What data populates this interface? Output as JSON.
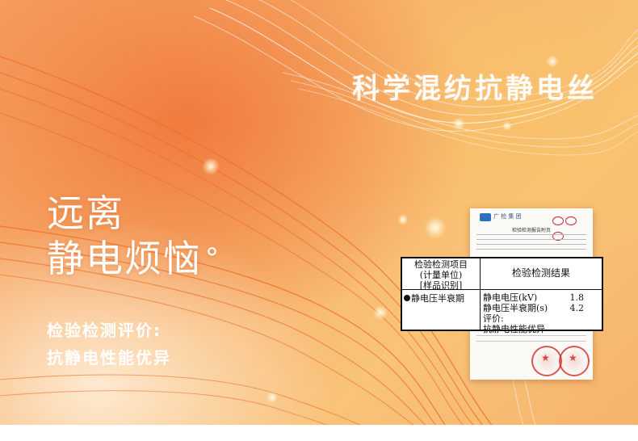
{
  "hero": {
    "headline": "科学混纺抗静电丝",
    "title_line1": "远离",
    "title_line2": "静电烦恼",
    "degree_mark": "°",
    "eval_line1": "检验检测评价:",
    "eval_line2": "抗静电性能优异"
  },
  "report": {
    "org_name": "广 检 集 团",
    "title": "检验检测报告附页"
  },
  "table": {
    "header_left": [
      "检验检测项目",
      "(计量单位)",
      "[样品识别]"
    ],
    "header_right": "检验检测结果",
    "row_item": "静电压半衰期",
    "results": [
      {
        "label": "静电电压(kV)",
        "value": "1.8"
      },
      {
        "label": "静电压半衰期(s)",
        "value": "4.2"
      }
    ],
    "eval_label": "评价:",
    "eval_text": "抗静电性能优异"
  },
  "colors": {
    "accent_orange": "#f07a3e",
    "light_gold": "#f9c37a",
    "stamp_red": "#d62828"
  }
}
